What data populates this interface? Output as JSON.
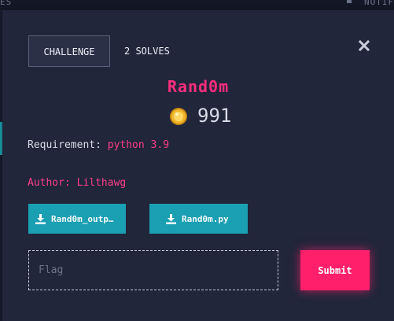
{
  "background": {
    "topbar_left_text": "ES",
    "topbar_right_text": "NOTIF"
  },
  "modal": {
    "tabs": {
      "challenge": "CHALLENGE",
      "solves": "2 SOLVES"
    },
    "title": "Rand0m",
    "points": "991",
    "requirement_label": "Requirement: ",
    "requirement_value": "python 3.9",
    "author": "Author: Lilthawg",
    "files": [
      {
        "label": "Rand0m_outp…"
      },
      {
        "label": "Rand0m.py"
      }
    ],
    "flag_placeholder": "Flag",
    "submit_label": "Submit"
  },
  "colors": {
    "accent_pink": "#ff1f6b",
    "accent_teal": "#1a9fb3",
    "modal_bg": "#21263a"
  }
}
